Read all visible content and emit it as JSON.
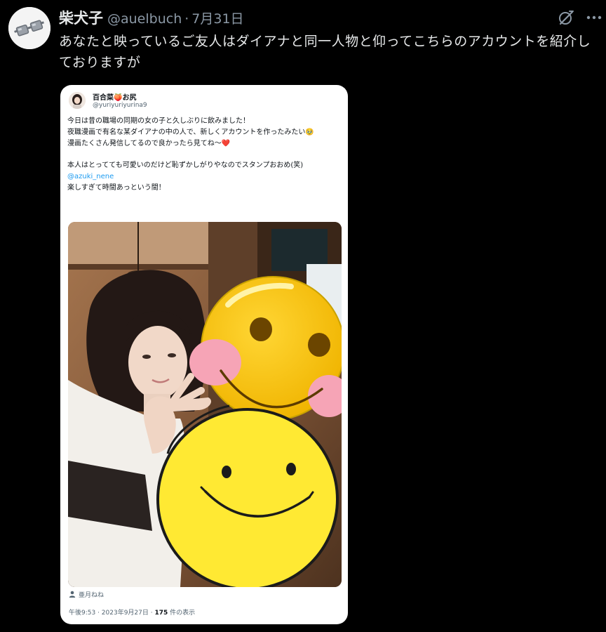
{
  "post": {
    "display_name": "柴犬子",
    "handle": "@auelbuch",
    "separator": "·",
    "date": "7月31日",
    "text": "あなたと映っているご友人はダイアナと同一人物と仰ってこちらのアカウントを紹介しておりますが",
    "avatar_icon": "glasses-avatar-icon"
  },
  "toolbar": {
    "grok_icon": "grok-icon",
    "more_icon": "more-icon"
  },
  "quoted": {
    "display_name": "百合菜🍑お尻",
    "handle": "@yuriyuriyurina9",
    "text_1": "今日は昔の職場の同期の女の子と久しぶりに飲みました！\n夜職漫画で有名な某ダイアナの中の人で、新しくアカウントを作ったみたい🥹\n漫画たくさん発信してるので良かったら見てね〜❤️\n\n本人はとってても可愛いのだけど恥ずかしがりやなのでスタンプおおめ(笑)\n",
    "mention": "@azuki_nene",
    "text_2": "\n楽しすぎて時間あっという間！",
    "photo_tag": "亜月ねね",
    "time": "午後9:53 · 2023年9月27日 · ",
    "views_count": "175",
    "views_label": " 件の表示"
  }
}
